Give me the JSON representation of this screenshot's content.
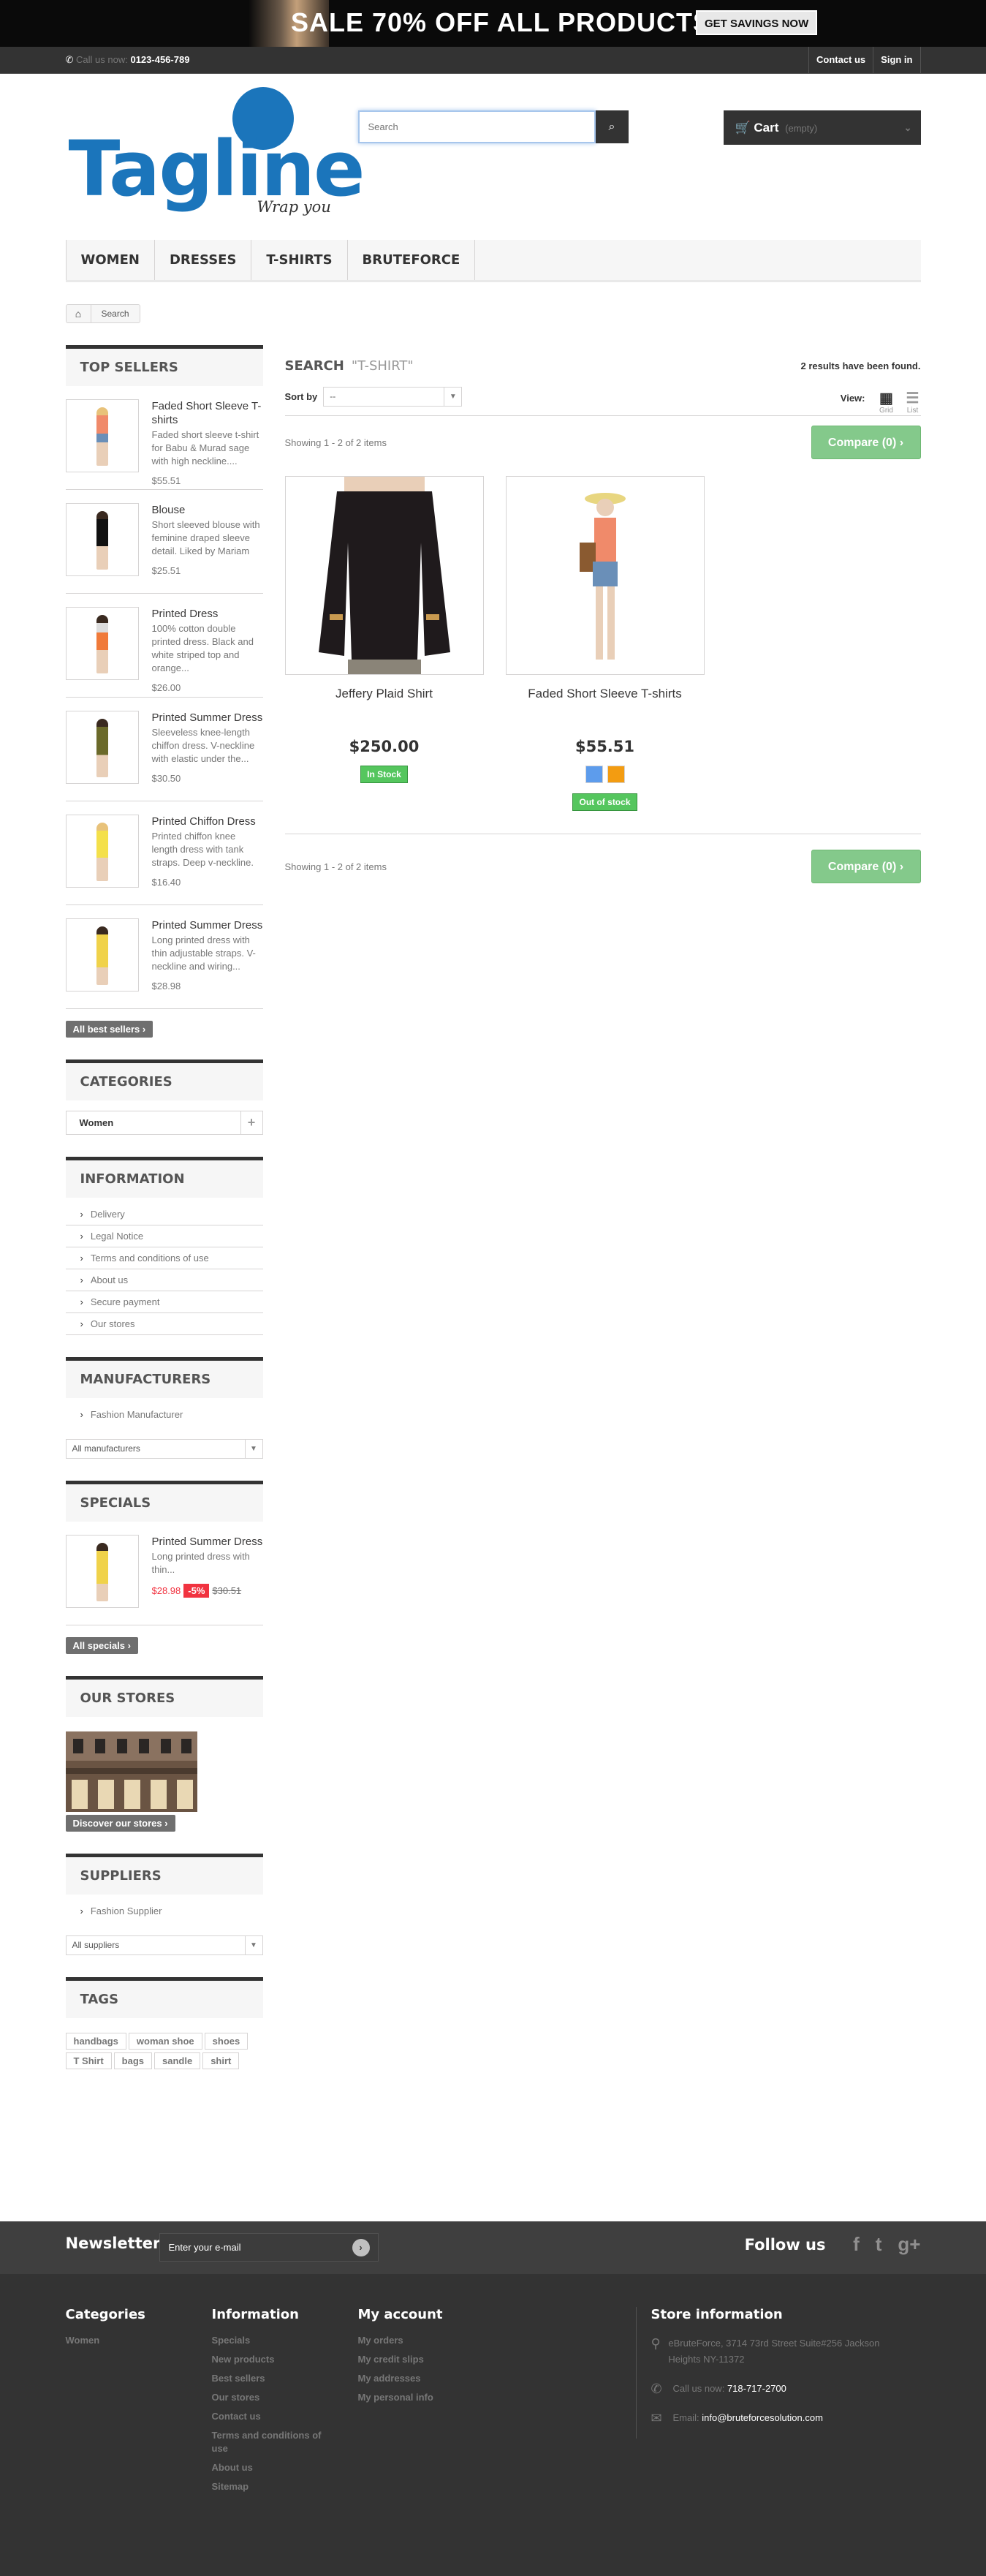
{
  "banner": {
    "sale_text": "SALE 70% OFF ALL PRODUCTS",
    "cta": "GET SAVINGS NOW"
  },
  "topnav": {
    "call_label": "Call us now:",
    "phone": "0123-456-789",
    "contact": "Contact us",
    "signin": "Sign in"
  },
  "logo": {
    "word": "Tagline",
    "tagline": "Wrap you"
  },
  "search": {
    "placeholder": "Search"
  },
  "cart": {
    "label": "Cart",
    "status": "(empty)"
  },
  "menu": [
    "WOMEN",
    "DRESSES",
    "T-SHIRTS",
    "BRUTEFORCE"
  ],
  "breadcrumb": {
    "current": "Search"
  },
  "top_sellers": {
    "title": "TOP SELLERS",
    "items": [
      {
        "name": "Faded Short Sleeve T-shirts",
        "desc": "Faded short sleeve t-shirt for Babu & Murad sage with high neckline....",
        "price": "$55.51"
      },
      {
        "name": "Blouse",
        "desc": "Short sleeved blouse with feminine draped sleeve detail. Liked by Mariam",
        "price": "$25.51"
      },
      {
        "name": "Printed Dress",
        "desc": "100% cotton double printed dress. Black and white striped top and orange...",
        "price": "$26.00"
      },
      {
        "name": "Printed Summer Dress",
        "desc": "Sleeveless knee-length chiffon dress. V-neckline with elastic under the...",
        "price": "$30.50"
      },
      {
        "name": "Printed Chiffon Dress",
        "desc": "Printed chiffon knee length dress with tank straps. Deep v-neckline.",
        "price": "$16.40"
      },
      {
        "name": "Printed Summer Dress",
        "desc": "Long printed dress with thin adjustable straps. V-neckline and wiring...",
        "price": "$28.98"
      }
    ],
    "all_button": "All best sellers"
  },
  "categories": {
    "title": "CATEGORIES",
    "items": [
      "Women"
    ]
  },
  "information": {
    "title": "INFORMATION",
    "items": [
      "Delivery",
      "Legal Notice",
      "Terms and conditions of use",
      "About us",
      "Secure payment",
      "Our stores"
    ]
  },
  "manufacturers": {
    "title": "MANUFACTURERS",
    "items": [
      "Fashion Manufacturer"
    ],
    "select": "All manufacturers"
  },
  "specials": {
    "title": "SPECIALS",
    "name": "Printed Summer Dress",
    "desc": "Long printed dress with thin...",
    "price": "$28.98",
    "discount": "-5%",
    "old_price": "$30.51",
    "all_button": "All specials"
  },
  "our_stores": {
    "title": "OUR STORES",
    "button": "Discover our stores"
  },
  "suppliers": {
    "title": "SUPPLIERS",
    "items": [
      "Fashion Supplier"
    ],
    "select": "All suppliers"
  },
  "tags": {
    "title": "TAGS",
    "items": [
      "handbags",
      "woman shoe",
      "shoes",
      "T Shirt",
      "bags",
      "sandle",
      "shirt"
    ]
  },
  "results": {
    "heading": "SEARCH",
    "query": "\"T-SHIRT\"",
    "count": "2 results have been found.",
    "sort_label": "Sort by",
    "sort_value": "--",
    "view_label": "View:",
    "grid": "Grid",
    "list": "List",
    "showing": "Showing 1 - 2 of 2 items",
    "compare": "Compare (0)"
  },
  "products": [
    {
      "name": "Jeffery Plaid Shirt",
      "price": "$250.00",
      "stock": "In Stock"
    },
    {
      "name": "Faded Short Sleeve T-shirts",
      "price": "$55.51",
      "stock": "Out of stock"
    }
  ],
  "newsletter": {
    "title": "Newsletter",
    "placeholder": "Enter your e-mail",
    "follow": "Follow us"
  },
  "footer": {
    "categories": {
      "title": "Categories",
      "items": [
        "Women"
      ]
    },
    "information": {
      "title": "Information",
      "items": [
        "Specials",
        "New products",
        "Best sellers",
        "Our stores",
        "Contact us",
        "Terms and conditions of use",
        "About us",
        "Sitemap"
      ]
    },
    "account": {
      "title": "My account",
      "items": [
        "My orders",
        "My credit slips",
        "My addresses",
        "My personal info"
      ]
    },
    "store": {
      "title": "Store information",
      "address": "eBruteForce, 3714 73rd Street Suite#256 Jackson Heights NY-11372",
      "call_label": "Call us now:",
      "phone": "718-717-2700",
      "email_label": "Email:",
      "email": "info@bruteforcesolution.com"
    }
  },
  "colors": {
    "accent": "#1b75bb",
    "compare": "#84c98b",
    "instock": "#55c65e",
    "discount": "#f13340",
    "swatch_blue": "#5d9cec",
    "swatch_orange": "#f39c11"
  }
}
